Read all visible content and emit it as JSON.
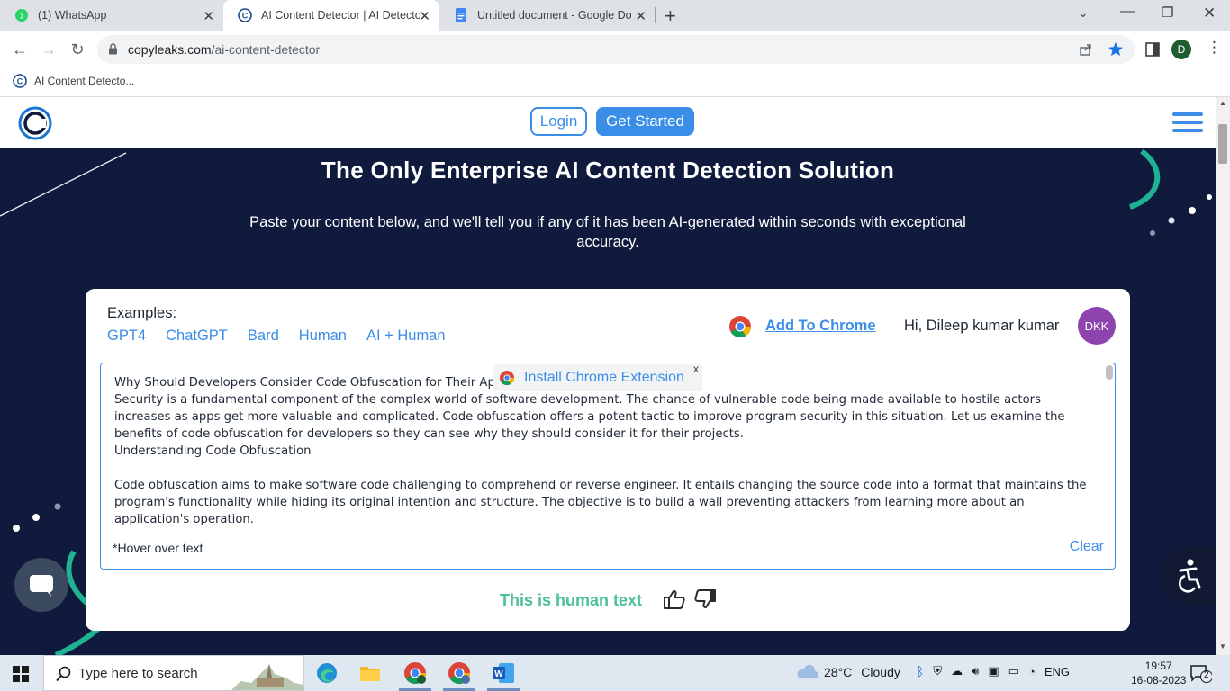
{
  "browser": {
    "tabs": [
      {
        "title": "(1) WhatsApp",
        "active": false
      },
      {
        "title": "AI Content Detector | AI Detector",
        "active": true
      },
      {
        "title": "Untitled document - Google Doc",
        "active": false
      }
    ],
    "url_host": "copyleaks.com",
    "url_path": "/ai-content-detector",
    "profile_initial": "D",
    "bookmark": "AI Content Detecto..."
  },
  "site": {
    "login_label": "Login",
    "get_started_label": "Get Started",
    "hero_title": "The Only Enterprise AI Content Detection Solution",
    "hero_subtitle": "Paste your content below, and we'll tell you if any of it has been AI-generated within seconds with exceptional accuracy."
  },
  "card": {
    "examples_label": "Examples:",
    "examples": [
      "GPT4",
      "ChatGPT",
      "Bard",
      "Human",
      "AI + Human"
    ],
    "add_to_chrome": "Add To Chrome",
    "greeting": "Hi, Dileep kumar kumar",
    "avatar_initials": "DKK",
    "text_lines": [
      "Why Should Developers Consider Code Obfuscation for Their Ap",
      "Security is a fundamental component of the complex world of software development. The chance of vulnerable code being made available to hostile actors increases as apps get more valuable and complicated. Code obfuscation offers a potent tactic to improve program security in this situation. Let us examine the benefits of code obfuscation for developers so they can see why they should consider it for their projects.",
      "Understanding Code Obfuscation",
      "",
      "Code obfuscation aims to make software code challenging to comprehend or reverse engineer. It entails changing the source code into a format that maintains the program's functionality while hiding its original intention and structure. The objective is to build a wall preventing attackers from learning more about an application's operation."
    ],
    "hover_note": "*Hover over text",
    "clear_label": "Clear",
    "extension_popup": "Install Chrome Extension",
    "extension_close": "x",
    "result": "This is human text"
  },
  "taskbar": {
    "search_placeholder": "Type here to search",
    "temperature": "28°C",
    "weather": "Cloudy",
    "language": "ENG",
    "time": "19:57",
    "date": "16-08-2023",
    "notifications": "2"
  },
  "colors": {
    "accent": "#3b8ee8",
    "hero_bg": "#0f1a3c",
    "result_green": "#4cbf9c",
    "avatar": "#8e44ad"
  }
}
